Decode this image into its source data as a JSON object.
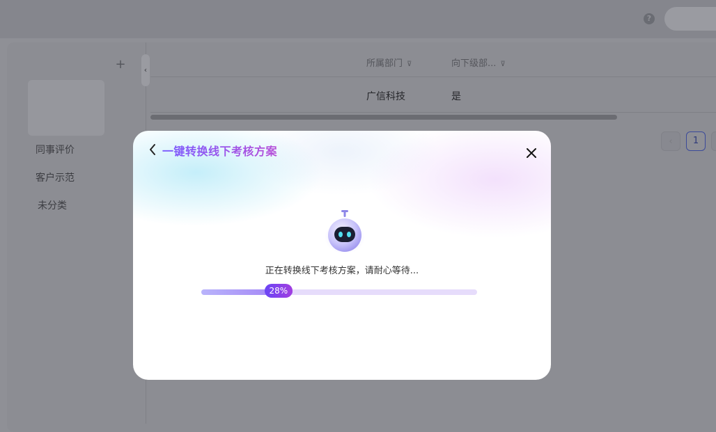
{
  "background": {
    "help_icon": "?",
    "categories": [
      "同事评价",
      "客户示范",
      "未分类"
    ],
    "table": {
      "headers": [
        "所属部门",
        "向下级部..."
      ],
      "row": [
        "广信科技",
        "是"
      ]
    },
    "pagination": {
      "current": "1"
    }
  },
  "modal": {
    "title": "一键转换线下考核方案",
    "status": "正在转换线下考核方案，请耐心等待...",
    "progress_fraction": 0.28,
    "progress_label": "28%"
  },
  "colors": {
    "accent": "#7a5cff",
    "accent_end": "#b64fd8",
    "overlay": "#8f9096"
  }
}
